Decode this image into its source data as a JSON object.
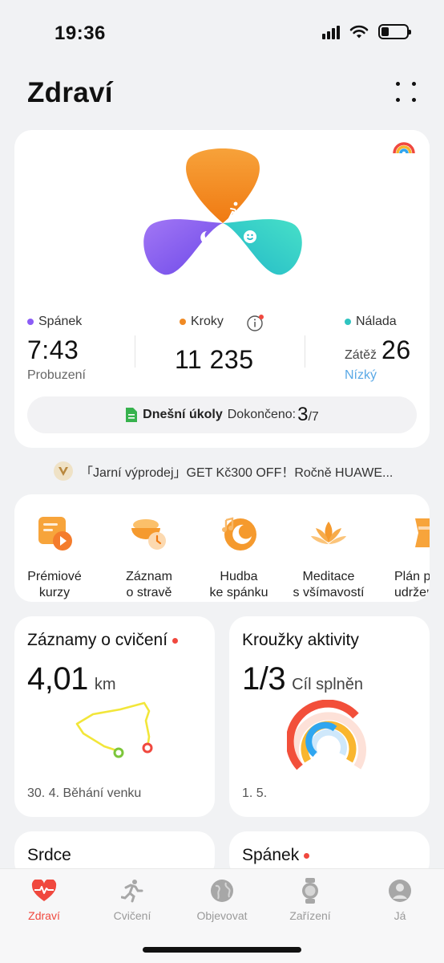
{
  "status_bar": {
    "time": "19:36",
    "battery_level": 0.3
  },
  "header": {
    "title": "Zdraví",
    "menu_icon": "grid-dots-icon"
  },
  "health_summary": {
    "sleep": {
      "label": "Spánek",
      "value": "7:43",
      "sub": "Probuzení",
      "color": "#8b5cf6"
    },
    "steps": {
      "label": "Kroky",
      "value": "11 235",
      "color": "#f08a24"
    },
    "mood": {
      "label": "Nálada",
      "prefix": "Zátěž",
      "value": "26",
      "sub": "Nízký",
      "color": "#2fc4c0"
    },
    "tasks": {
      "label": "Dnešní úkoly",
      "done_label": "Dokončeno:",
      "done_count": "3",
      "total": "/7"
    }
  },
  "promo": {
    "text": "「Jarní výprodej」GET Kč300 OFF！Ročně HUAWE..."
  },
  "shortcuts": [
    {
      "line1": "Prémiové",
      "line2": "kurzy",
      "icon": "video-course-icon"
    },
    {
      "line1": "Záznam",
      "line2": "o stravě",
      "icon": "meal-log-icon"
    },
    {
      "line1": "Hudba",
      "line2": "ke spánku",
      "icon": "sleep-music-icon"
    },
    {
      "line1": "Meditace",
      "line2": "s všímavostí",
      "icon": "lotus-icon"
    },
    {
      "line1": "Plán p",
      "line2": "udržení",
      "icon": "body-plan-icon"
    }
  ],
  "exercise": {
    "title": "Záznamy o cvičení",
    "value": "4,01",
    "unit": "km",
    "footer": "30. 4. Běhání venku"
  },
  "activity": {
    "title": "Kroužky aktivity",
    "value": "1/3",
    "unit": "Cíl splněn",
    "footer": "1. 5."
  },
  "heart": {
    "title": "Srdce"
  },
  "sleep_tile": {
    "title": "Spánek"
  },
  "tabs": [
    {
      "label": "Zdraví",
      "icon": "heart-pulse-icon",
      "active": true
    },
    {
      "label": "Cvičení",
      "icon": "running-icon",
      "active": false
    },
    {
      "label": "Objevovat",
      "icon": "globe-icon",
      "active": false
    },
    {
      "label": "Zařízení",
      "icon": "watch-icon",
      "active": false
    },
    {
      "label": "Já",
      "icon": "profile-icon",
      "active": false
    }
  ]
}
